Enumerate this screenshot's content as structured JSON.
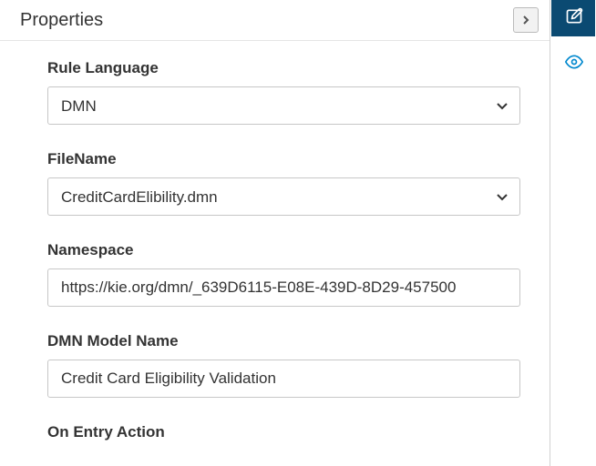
{
  "header": {
    "title": "Properties"
  },
  "fields": {
    "rule_language": {
      "label": "Rule Language",
      "value": "DMN"
    },
    "file_name": {
      "label": "FileName",
      "value": "CreditCardElibility.dmn"
    },
    "namespace": {
      "label": "Namespace",
      "value": "https://kie.org/dmn/_639D6115-E08E-439D-8D29-457500"
    },
    "dmn_model_name": {
      "label": "DMN Model Name",
      "value": "Credit Card Eligibility Validation"
    },
    "on_entry_action": {
      "label": "On Entry Action"
    }
  }
}
